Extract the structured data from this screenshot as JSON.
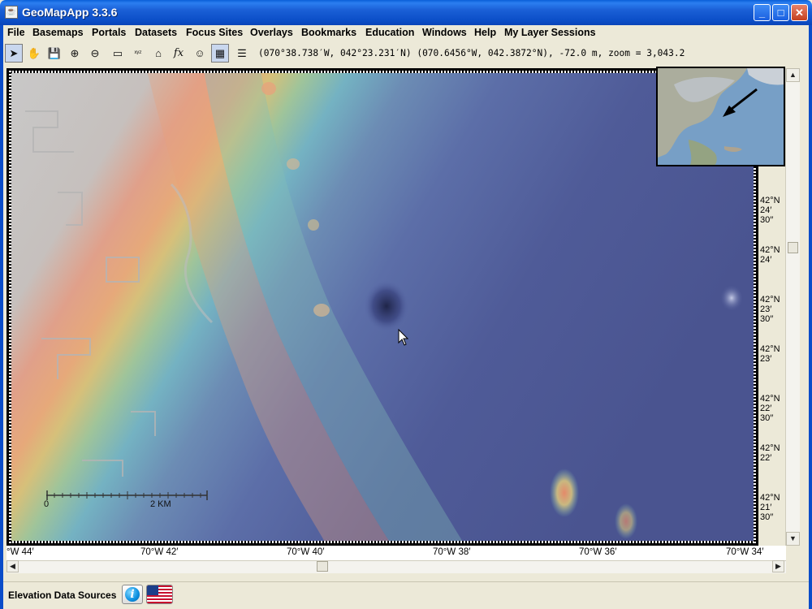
{
  "window": {
    "title": "GeoMapApp 3.3.6",
    "app_icon_glyph": "☕",
    "minimize_glyph": "_",
    "maximize_glyph": "□",
    "close_glyph": "✕"
  },
  "menu": {
    "items": [
      "File",
      "Basemaps",
      "Portals",
      "Datasets",
      "Focus Sites",
      "Overlays",
      "Bookmarks",
      "Education",
      "Windows",
      "Help",
      "My Layer Sessions"
    ]
  },
  "toolbar": {
    "tools": [
      {
        "name": "select-arrow-icon",
        "glyph": "➤",
        "active": true
      },
      {
        "name": "pan-hand-icon",
        "glyph": "✋",
        "active": false
      },
      {
        "name": "save-disk-icon",
        "glyph": "💾",
        "active": false
      },
      {
        "name": "zoom-in-icon",
        "glyph": "⊕",
        "active": false
      },
      {
        "name": "zoom-out-icon",
        "glyph": "⊖",
        "active": false
      },
      {
        "name": "ruler-icon",
        "glyph": "▭",
        "active": false
      },
      {
        "name": "xyz-grid-icon",
        "glyph": "ˣʸᶻ",
        "active": false
      },
      {
        "name": "profile-lasso-icon",
        "glyph": "⌂",
        "active": false
      },
      {
        "name": "function-fx-icon",
        "glyph": "fx",
        "active": false
      },
      {
        "name": "face-icon",
        "glyph": "☺",
        "active": false
      },
      {
        "name": "grid-toggle-icon",
        "glyph": "▦",
        "active": true
      },
      {
        "name": "layers-list-icon",
        "glyph": "☰",
        "active": false
      }
    ],
    "coordinate_readout": "(070°38.738′W, 042°23.231′N) (070.6456°W, 042.3872°N), -72.0 m, zoom = 3,043.2"
  },
  "map": {
    "scale_bar": {
      "left_label": "0",
      "right_label": "2 KM"
    },
    "lat_labels": [
      "42°N\n24′\n30′′",
      "42°N\n24′",
      "42°N\n23′\n30′′",
      "42°N\n23′",
      "42°N\n22′\n30′′",
      "42°N\n22′",
      "42°N\n21′\n30′′"
    ],
    "lon_labels": [
      "°W 44′",
      "70°W 42′",
      "70°W 40′",
      "70°W 38′",
      "70°W 36′",
      "70°W 34′"
    ]
  },
  "status": {
    "label": "Elevation Data Sources",
    "info_glyph": "i"
  }
}
